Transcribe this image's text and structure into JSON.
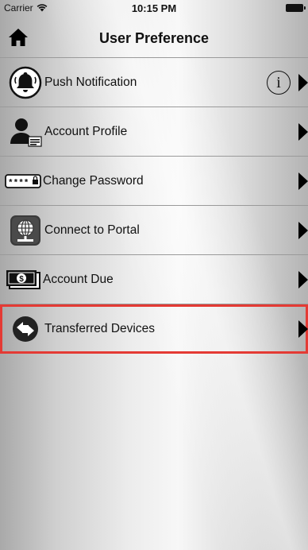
{
  "status_bar": {
    "carrier": "Carrier",
    "time": "10:15 PM"
  },
  "header": {
    "title": "User Preference",
    "home_icon": "home-icon"
  },
  "menu": {
    "items": [
      {
        "label": "Push Notification",
        "icon": "bell-icon",
        "has_info": true
      },
      {
        "label": "Account Profile",
        "icon": "user-card-icon"
      },
      {
        "label": "Change Password",
        "icon": "password-icon",
        "password_mask": "****"
      },
      {
        "label": "Connect to Portal",
        "icon": "globe-portal-icon"
      },
      {
        "label": "Account Due",
        "icon": "money-icon",
        "money_symbol": "$"
      },
      {
        "label": "Transferred Devices",
        "icon": "transfer-icon",
        "highlighted": true
      }
    ],
    "info_glyph": "i"
  },
  "colors": {
    "highlight_border": "#e43a34"
  }
}
